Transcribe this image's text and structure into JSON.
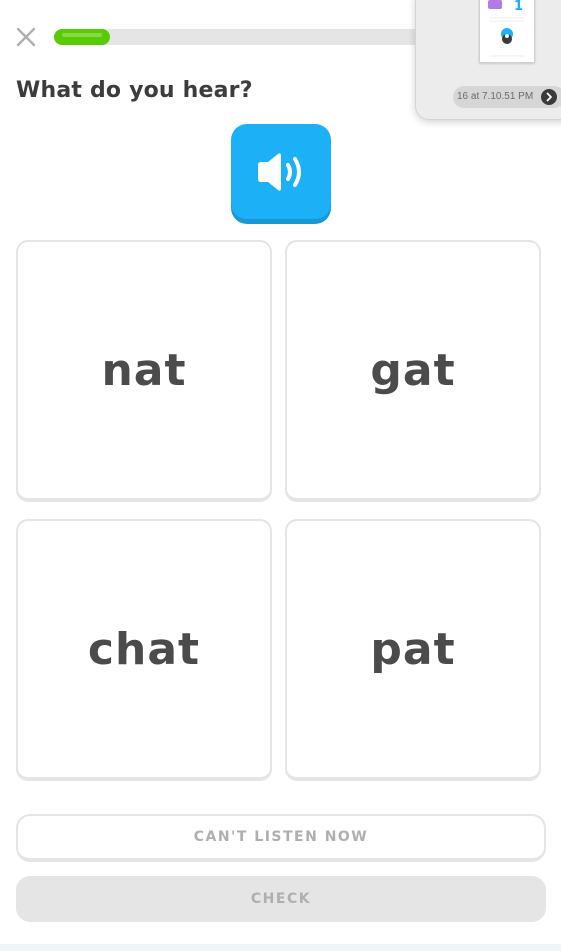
{
  "header": {
    "close_icon": "close-icon",
    "progress": 0.14,
    "progress_color": "#58cc02"
  },
  "prompt": "What do you hear?",
  "speaker": {
    "icon": "speaker-icon",
    "color": "#1cb0f6"
  },
  "options": [
    {
      "word": "nat"
    },
    {
      "word": "gat"
    },
    {
      "word": "chat"
    },
    {
      "word": "pat"
    }
  ],
  "footer": {
    "cant_listen_label": "CAN'T LISTEN NOW",
    "check_label": "CHECK"
  },
  "screenshot_thumbnail": {
    "badge_number": "1",
    "caption": "16 at 7.10.51 PM",
    "arrow_icon": "chevron-right-icon"
  }
}
